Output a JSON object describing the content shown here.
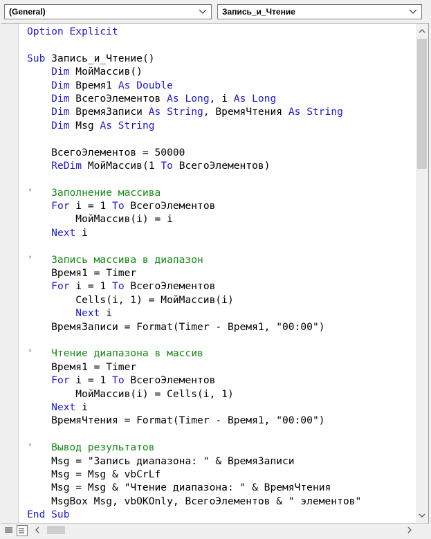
{
  "procedure_dropdown": {
    "value": "(General)"
  },
  "member_dropdown": {
    "value": "Запись_и_Чтение"
  },
  "code_lines": [
    [
      {
        "t": "Option Explicit",
        "c": "kw"
      }
    ],
    [],
    [
      {
        "t": "Sub ",
        "c": "kw"
      },
      {
        "t": "Запись_и_Чтение()",
        "c": ""
      }
    ],
    [
      {
        "t": "    "
      },
      {
        "t": "Dim",
        "c": "kw"
      },
      {
        "t": " МойМассив()",
        "c": ""
      }
    ],
    [
      {
        "t": "    "
      },
      {
        "t": "Dim",
        "c": "kw"
      },
      {
        "t": " Время1 ",
        "c": ""
      },
      {
        "t": "As Double",
        "c": "kw"
      }
    ],
    [
      {
        "t": "    "
      },
      {
        "t": "Dim",
        "c": "kw"
      },
      {
        "t": " ВсегоЭлементов ",
        "c": ""
      },
      {
        "t": "As Long",
        "c": "kw"
      },
      {
        "t": ", i ",
        "c": ""
      },
      {
        "t": "As Long",
        "c": "kw"
      }
    ],
    [
      {
        "t": "    "
      },
      {
        "t": "Dim",
        "c": "kw"
      },
      {
        "t": " ВремяЗаписи ",
        "c": ""
      },
      {
        "t": "As String",
        "c": "kw"
      },
      {
        "t": ", ВремяЧтения ",
        "c": ""
      },
      {
        "t": "As String",
        "c": "kw"
      }
    ],
    [
      {
        "t": "    "
      },
      {
        "t": "Dim",
        "c": "kw"
      },
      {
        "t": " Msg ",
        "c": ""
      },
      {
        "t": "As String",
        "c": "kw"
      }
    ],
    [],
    [
      {
        "t": "    ВсегоЭлементов = 50000",
        "c": ""
      }
    ],
    [
      {
        "t": "    "
      },
      {
        "t": "ReDim",
        "c": "kw"
      },
      {
        "t": " МойМассив(1 ",
        "c": ""
      },
      {
        "t": "To",
        "c": "kw"
      },
      {
        "t": " ВсегоЭлементов)",
        "c": ""
      }
    ],
    [],
    [
      {
        "t": "'   Заполнение массива",
        "c": "cm"
      }
    ],
    [
      {
        "t": "    "
      },
      {
        "t": "For",
        "c": "kw"
      },
      {
        "t": " i = 1 ",
        "c": ""
      },
      {
        "t": "To",
        "c": "kw"
      },
      {
        "t": " ВсегоЭлементов",
        "c": ""
      }
    ],
    [
      {
        "t": "        МойМассив(i) = i",
        "c": ""
      }
    ],
    [
      {
        "t": "    "
      },
      {
        "t": "Next",
        "c": "kw"
      },
      {
        "t": " i",
        "c": ""
      }
    ],
    [],
    [
      {
        "t": "'   Запись массива в диапазон",
        "c": "cm"
      }
    ],
    [
      {
        "t": "    Время1 = Timer",
        "c": ""
      }
    ],
    [
      {
        "t": "    "
      },
      {
        "t": "For",
        "c": "kw"
      },
      {
        "t": " i = 1 ",
        "c": ""
      },
      {
        "t": "To",
        "c": "kw"
      },
      {
        "t": " ВсегоЭлементов",
        "c": ""
      }
    ],
    [
      {
        "t": "        Cells(i, 1) = МойМассив(i)",
        "c": ""
      }
    ],
    [
      {
        "t": "        "
      },
      {
        "t": "Next",
        "c": "kw"
      },
      {
        "t": " i",
        "c": ""
      }
    ],
    [
      {
        "t": "    ВремяЗаписи = Format(Timer - Время1, \"00:00\")",
        "c": ""
      }
    ],
    [],
    [
      {
        "t": "'   Чтение диапазона в массив",
        "c": "cm"
      }
    ],
    [
      {
        "t": "    Время1 = Timer",
        "c": ""
      }
    ],
    [
      {
        "t": "    "
      },
      {
        "t": "For",
        "c": "kw"
      },
      {
        "t": " i = 1 ",
        "c": ""
      },
      {
        "t": "To",
        "c": "kw"
      },
      {
        "t": " ВсегоЭлементов",
        "c": ""
      }
    ],
    [
      {
        "t": "        МойМассив(i) = Cells(i, 1)",
        "c": ""
      }
    ],
    [
      {
        "t": "    "
      },
      {
        "t": "Next",
        "c": "kw"
      },
      {
        "t": " i",
        "c": ""
      }
    ],
    [
      {
        "t": "    ВремяЧтения = Format(Timer - Время1, \"00:00\")",
        "c": ""
      }
    ],
    [],
    [
      {
        "t": "'   Вывод результатов",
        "c": "cm"
      }
    ],
    [
      {
        "t": "    Msg = \"Запись диапазона: \" & ВремяЗаписи",
        "c": ""
      }
    ],
    [
      {
        "t": "    Msg = Msg & vbCrLf",
        "c": ""
      }
    ],
    [
      {
        "t": "    Msg = Msg & \"Чтение диапазона: \" & ВремяЧтения",
        "c": ""
      }
    ],
    [
      {
        "t": "    MsgBox Msg, vbOKOnly, ВсегоЭлементов & \" элементов\"",
        "c": ""
      }
    ],
    [
      {
        "t": "End Sub",
        "c": "kw"
      }
    ]
  ],
  "colors": {
    "keyword": "#1d1ad3",
    "comment": "#138a13",
    "text": "#000000"
  }
}
